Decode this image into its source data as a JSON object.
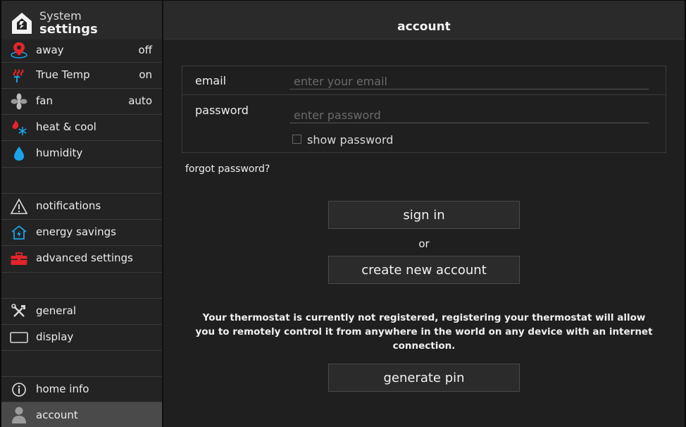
{
  "brand": {
    "line1": "System",
    "line2": "settings",
    "icon": "house-logo-icon"
  },
  "sidebar": {
    "items": [
      {
        "label": "away",
        "value": "off",
        "icon": "location-pin-icon"
      },
      {
        "label": "True Temp",
        "value": "on",
        "icon": "heat-waves-icon"
      },
      {
        "label": "fan",
        "value": "auto",
        "icon": "fan-icon"
      },
      {
        "label": "heat & cool",
        "value": "",
        "icon": "flame-snowflake-icon"
      },
      {
        "label": "humidity",
        "value": "",
        "icon": "water-drop-icon"
      },
      {
        "label": "notifications",
        "value": "",
        "icon": "warning-triangle-icon"
      },
      {
        "label": "energy savings",
        "value": "",
        "icon": "energy-house-icon"
      },
      {
        "label": "advanced settings",
        "value": "",
        "icon": "toolbox-icon"
      },
      {
        "label": "general",
        "value": "",
        "icon": "tools-icon"
      },
      {
        "label": "display",
        "value": "",
        "icon": "display-icon"
      },
      {
        "label": "home info",
        "value": "",
        "icon": "info-circle-icon"
      },
      {
        "label": "account",
        "value": "",
        "icon": "user-icon"
      }
    ]
  },
  "main": {
    "title": "account",
    "form": {
      "email_label": "email",
      "email_placeholder": "enter your email",
      "password_label": "password",
      "password_placeholder": "enter password",
      "show_password_label": "show password"
    },
    "forgot_password": "forgot password?",
    "sign_in": "sign in",
    "or": "or",
    "create_account": "create new account",
    "message_line1": "Your thermostat is currently not registered, registering your thermostat will allow",
    "message_line2": "you to remotely control it from anywhere in  the world on any device with an internet connection.",
    "generate_pin": "generate pin"
  },
  "colors": {
    "background": "#1f1f1f",
    "active": "#4a4a4a",
    "accent_red": "#e3242b",
    "accent_blue": "#1aa3e8"
  }
}
